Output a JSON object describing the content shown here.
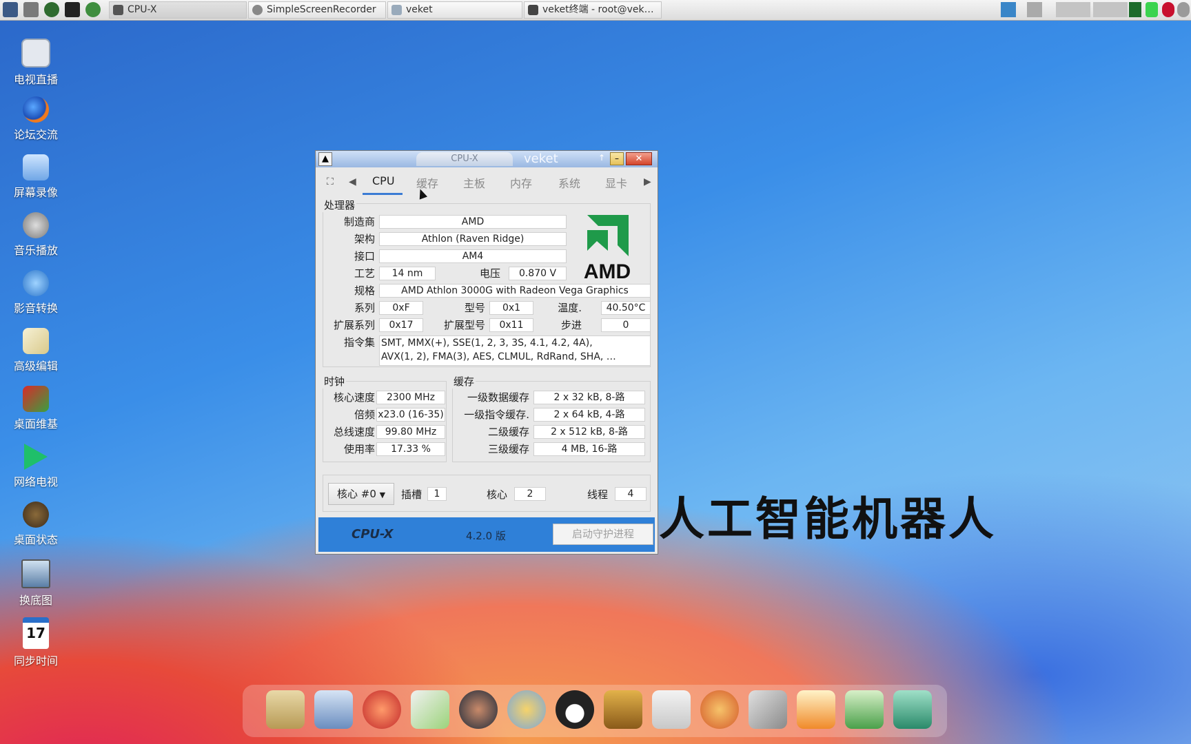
{
  "taskbar": {
    "tasks": [
      {
        "label": "CPU-X"
      },
      {
        "label": "SimpleScreenRecorder"
      },
      {
        "label": "veket"
      },
      {
        "label": "veket终端 - root@vek…"
      }
    ]
  },
  "desktop_icons": [
    {
      "label": "电视直播",
      "icon": "tv-icon"
    },
    {
      "label": "论坛交流",
      "icon": "firefox-icon"
    },
    {
      "label": "屏幕录像",
      "icon": "screen-record-icon"
    },
    {
      "label": "音乐播放",
      "icon": "music-icon"
    },
    {
      "label": "影音转换",
      "icon": "media-convert-icon"
    },
    {
      "label": "高级编辑",
      "icon": "editor-icon"
    },
    {
      "label": "桌面维基",
      "icon": "wiki-icon"
    },
    {
      "label": "网络电视",
      "icon": "play-icon"
    },
    {
      "label": "桌面状态",
      "icon": "status-icon"
    },
    {
      "label": "换底图",
      "icon": "wallpaper-icon"
    },
    {
      "label": "同步时间",
      "icon": "calendar-icon"
    }
  ],
  "calendar_day": "17",
  "overlay_text": "人工智能机器人",
  "window": {
    "tab_title": "CPU-X",
    "title": "veket",
    "tabs": [
      "CPU",
      "缓存",
      "主板",
      "内存",
      "系统",
      "显卡"
    ],
    "processor": {
      "section": "处理器",
      "vendor_label": "制造商",
      "vendor": "AMD",
      "codename_label": "架构",
      "codename": "Athlon (Raven Ridge)",
      "package_label": "接口",
      "package": "AM4",
      "technology_label": "工艺",
      "technology": "14 nm",
      "voltage_label": "电压",
      "voltage": "0.870 V",
      "spec_label": "规格",
      "spec": "AMD Athlon 3000G with Radeon Vega Graphics",
      "family_label": "系列",
      "family": "0xF",
      "model_label": "型号",
      "model": "0x1",
      "temp_label": "温度.",
      "temp": "40.50°C",
      "extfamily_label": "扩展系列",
      "extfamily": "0x17",
      "extmodel_label": "扩展型号",
      "extmodel": "0x11",
      "stepping_label": "步进",
      "stepping": "0",
      "instructions_label": "指令集",
      "instructions_line1": "SMT, MMX(+), SSE(1, 2, 3, 3S, 4.1, 4.2, 4A),",
      "instructions_line2": "AVX(1, 2), FMA(3), AES, CLMUL, RdRand, SHA, …",
      "logo_text": "AMD"
    },
    "clocks": {
      "section": "时钟",
      "core_speed_label": "核心速度",
      "core_speed": "2300 MHz",
      "multiplier_label": "倍频",
      "multiplier": "x23.0 (16-35)",
      "bus_speed_label": "总线速度",
      "bus_speed": "99.80 MHz",
      "usage_label": "使用率",
      "usage": "17.33 %"
    },
    "cache": {
      "section": "缓存",
      "l1d_label": "一级数据缓存",
      "l1d": "2 x 32 kB, 8-路",
      "l1i_label": "一级指令缓存.",
      "l1i": "2 x 64 kB, 4-路",
      "l2_label": "二级缓存",
      "l2": "2 x 512 kB, 8-路",
      "l3_label": "三级缓存",
      "l3": "4 MB, 16-路"
    },
    "bottom": {
      "core_select": "核心 #0",
      "sockets_label": "插槽",
      "sockets": "1",
      "cores_label": "核心",
      "cores": "2",
      "threads_label": "线程",
      "threads": "4"
    },
    "footer": {
      "brand": "CPU-X",
      "version": "4.2.0 版",
      "daemon_button": "启动守护进程"
    }
  },
  "colors": {
    "accent": "#3b7bd4",
    "footer": "#2f80d8",
    "amd_green": "#1f9a4a"
  }
}
